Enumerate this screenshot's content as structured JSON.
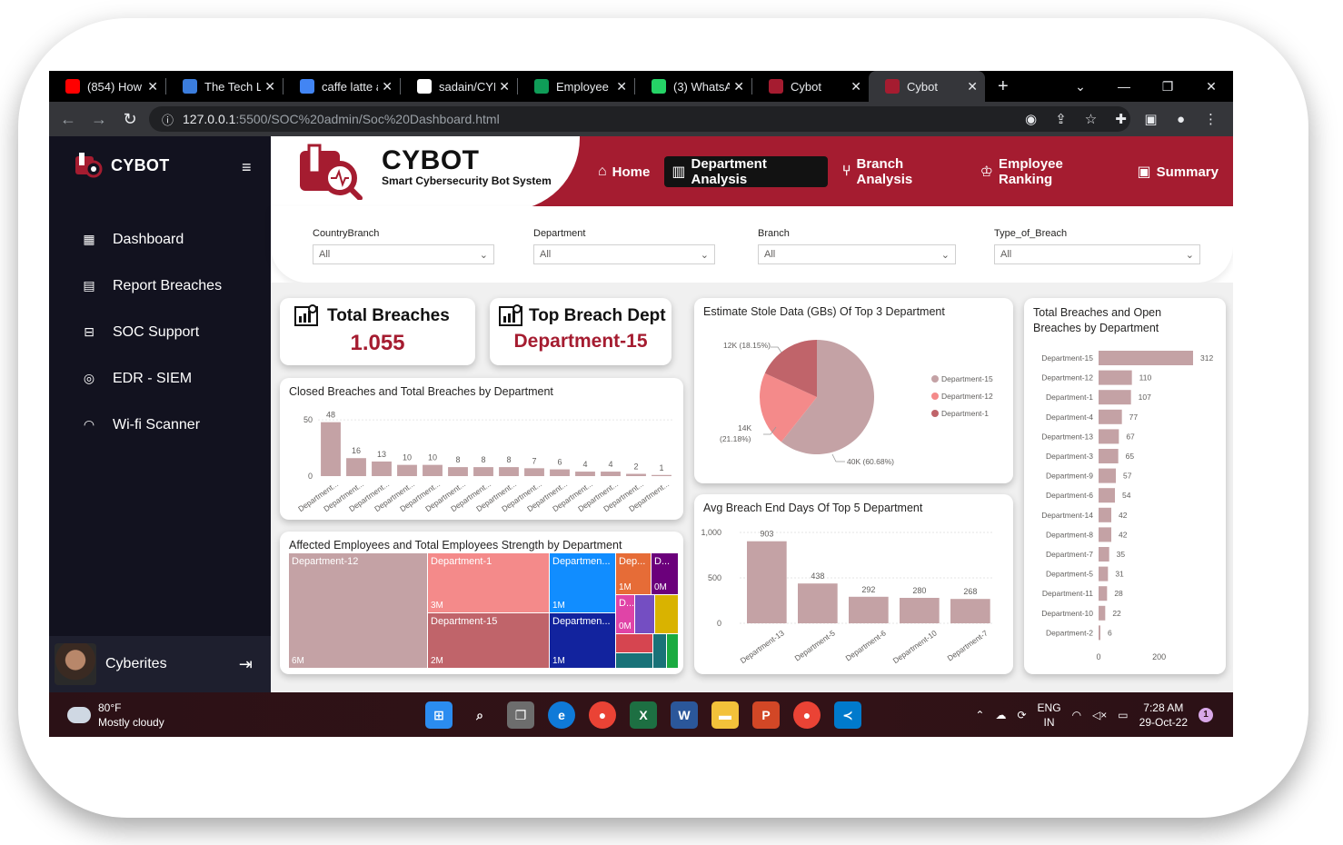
{
  "browser": {
    "tabs": [
      {
        "title": "(854) How t",
        "icon": "youtube-icon",
        "color": "#ff0000"
      },
      {
        "title": "The Tech La",
        "icon": "site-icon",
        "color": "#3b7ddd"
      },
      {
        "title": "caffe latte a",
        "icon": "google-icon",
        "color": "#4285f4"
      },
      {
        "title": "sadain/CYE",
        "icon": "github-icon",
        "color": "#ffffff"
      },
      {
        "title": "Employee S",
        "icon": "sheets-icon",
        "color": "#0f9d58"
      },
      {
        "title": "(3) WhatsA",
        "icon": "whatsapp-icon",
        "color": "#25d366"
      },
      {
        "title": "Cybot",
        "icon": "cybot-icon",
        "color": "#a51c30"
      },
      {
        "title": "Cybot",
        "icon": "cybot-icon",
        "color": "#a51c30"
      }
    ],
    "url_host": "127.0.0.1",
    "url_path": ":5500/SOC%20admin/Soc%20Dashboard.html"
  },
  "sidebar": {
    "brand": "CYBOT",
    "items": [
      {
        "label": "Dashboard",
        "icon": "grid-icon"
      },
      {
        "label": "Report Breaches",
        "icon": "document-icon"
      },
      {
        "label": "SOC Support",
        "icon": "support-icon"
      },
      {
        "label": "EDR - SIEM",
        "icon": "shield-icon"
      },
      {
        "label": "Wi-fi Scanner",
        "icon": "wifi-icon"
      }
    ],
    "user": "Cyberites"
  },
  "header": {
    "title": "CYBOT",
    "subtitle": "Smart Cybersecurity Bot System",
    "nav": [
      {
        "label": "Home",
        "icon": "home-icon",
        "active": false
      },
      {
        "label": "Department Analysis",
        "icon": "bar-chart-icon",
        "active": true
      },
      {
        "label": "Branch Analysis",
        "icon": "branch-icon",
        "active": false
      },
      {
        "label": "Employee Ranking",
        "icon": "ranking-icon",
        "active": false
      },
      {
        "label": "Summary",
        "icon": "summary-icon",
        "active": false
      }
    ]
  },
  "filters": [
    {
      "label": "CountryBranch",
      "value": "All"
    },
    {
      "label": "Department",
      "value": "All"
    },
    {
      "label": "Branch",
      "value": "All"
    },
    {
      "label": "Type_of_Breach",
      "value": "All"
    }
  ],
  "kpis": {
    "total_breaches": {
      "label": "Total Breaches",
      "value": "1.055"
    },
    "top_dept": {
      "label": "Top Breach Dept",
      "value": "Department-15"
    }
  },
  "colors": {
    "brand": "#a51c30",
    "bar": "#c4a2a5"
  },
  "chart_data": [
    {
      "id": "closed",
      "type": "bar",
      "title": "Closed Breaches and Total Breaches by Department",
      "categories": [
        "Department...",
        "Department...",
        "Department...",
        "Department...",
        "Department...",
        "Department...",
        "Department...",
        "Department...",
        "Department...",
        "Department...",
        "Department...",
        "Department...",
        "Department...",
        "Department..."
      ],
      "values": [
        48,
        16,
        13,
        10,
        10,
        8,
        8,
        8,
        7,
        6,
        4,
        4,
        2,
        1
      ],
      "yticks": [
        "0",
        "50"
      ],
      "ylim": [
        0,
        55
      ]
    },
    {
      "id": "pie",
      "type": "pie",
      "title": "Estimate Stole Data (GBs) Of Top 3 Department",
      "slices": [
        {
          "name": "Department-15",
          "value": 60.68,
          "label": "40K (60.68%)",
          "color": "#c4a2a5"
        },
        {
          "name": "Department-12",
          "value": 21.18,
          "label_line1": "14K",
          "label_line2": "(21.18%)",
          "color": "#f48a8a"
        },
        {
          "name": "Department-1",
          "value": 18.15,
          "label": "12K (18.15%)",
          "color": "#c0646a"
        }
      ],
      "legend": "right"
    },
    {
      "id": "avgdays",
      "type": "bar",
      "title": "Avg Breach End Days Of Top 5 Department",
      "categories": [
        "Department-13",
        "Department-5",
        "Department-6",
        "Department-10",
        "Department-7"
      ],
      "values": [
        903,
        438,
        292,
        280,
        268
      ],
      "yticks": [
        "0",
        "500",
        "1,000"
      ],
      "ylim": [
        0,
        1000
      ]
    },
    {
      "id": "hbar",
      "type": "bar",
      "title": "Total Breaches and Open Breaches by Department",
      "title_line1": "Total Breaches and Open",
      "title_line2": "Breaches by Department",
      "categories": [
        "Department-15",
        "Department-12",
        "Department-1",
        "Department-4",
        "Department-13",
        "Department-3",
        "Department-9",
        "Department-6",
        "Department-14",
        "Department-8",
        "Department-7",
        "Department-5",
        "Department-11",
        "Department-10",
        "Department-2"
      ],
      "values": [
        312,
        110,
        107,
        77,
        67,
        65,
        57,
        54,
        42,
        42,
        35,
        31,
        28,
        22,
        6
      ],
      "xticks": [
        "0",
        "200"
      ],
      "xlim": [
        0,
        330
      ]
    },
    {
      "id": "treemap",
      "type": "heatmap",
      "title": "Affected Employees and Total Employees Strength by Department",
      "tiles": [
        {
          "name": "Department-12",
          "value": "6M",
          "color": "#c4a2a5"
        },
        {
          "name": "Department-1",
          "value": "3M",
          "color": "#f48a8a"
        },
        {
          "name": "Department-15",
          "value": "2M",
          "color": "#c0646a"
        },
        {
          "name": "Departmen...",
          "value": "1M",
          "color": "#118dff"
        },
        {
          "name": "Departmen...",
          "value": "1M",
          "color": "#12239e"
        },
        {
          "name": "Dep...",
          "value": "1M",
          "color": "#e66c37"
        },
        {
          "name": "D...",
          "value": "0M",
          "color": "#6b007b"
        },
        {
          "name": "D...",
          "value": "0M",
          "color": "#e044a7"
        }
      ]
    }
  ],
  "taskbar": {
    "temp": "80°F",
    "weather": "Mostly cloudy",
    "lang1": "ENG",
    "lang2": "IN",
    "time": "7:28 AM",
    "date": "29-Oct-22",
    "notifications": "1"
  }
}
